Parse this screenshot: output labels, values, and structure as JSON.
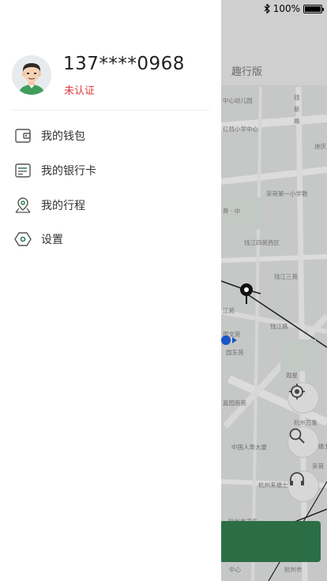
{
  "status_bar": {
    "battery": "100%",
    "bluetooth_icon": "bluetooth-icon",
    "battery_icon": "battery-icon"
  },
  "map": {
    "title": "趣行版",
    "labels": [
      "中心幼儿园",
      "钱",
      "新",
      "路",
      "红档小学中心",
      "迪庆",
      "采荷第一小学教",
      "奔 · 中",
      "钱江四苑西区",
      "钱江三苑",
      "江苑",
      "钱江路",
      "邵文苑",
      "园东苑",
      "观星",
      "嘉园南苑",
      "杭州万象",
      "中国人寿大厦",
      "杭州来福士",
      "杭州市卫生",
      "采荷",
      "中心",
      "杭州市",
      "来福士"
    ]
  },
  "drawer": {
    "phone": "137****0968",
    "verify_status": "未认证",
    "menu": [
      {
        "label": "我的钱包",
        "icon": "wallet-icon"
      },
      {
        "label": "我的银行卡",
        "icon": "bank-card-icon"
      },
      {
        "label": "我的行程",
        "icon": "location-pin-icon"
      },
      {
        "label": "设置",
        "icon": "settings-icon"
      }
    ]
  },
  "colors": {
    "accent_green": "#2e7d4f",
    "unverified_red": "#e23b3b",
    "bottom_bar": "#2b6e46"
  }
}
